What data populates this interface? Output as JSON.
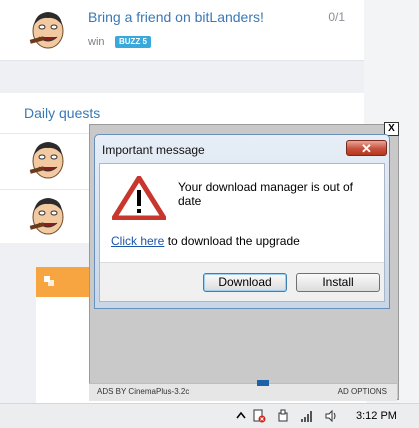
{
  "quest": {
    "title": "Bring a friend on bitLanders!",
    "progress": "0/1",
    "reward_label": "win",
    "badge": "BUZZ 5"
  },
  "daily": {
    "title": "Daily quests"
  },
  "ad": {
    "close": "X",
    "ads_by": "ADS BY CinemaPlus-3.2c",
    "options": "AD OPTIONS"
  },
  "dialog": {
    "title": "Important message",
    "close": "✕",
    "message": "Your download manager is out of date",
    "link": "Click here",
    "link_suffix": " to download the upgrade",
    "download_label": "Download",
    "install_label": "Install"
  },
  "taskbar": {
    "clock": "3:12 PM"
  },
  "colors": {
    "accent": "#3a78b5",
    "badge": "#39a9dc",
    "orange": "#f7a541",
    "warning": "#c8372d"
  }
}
